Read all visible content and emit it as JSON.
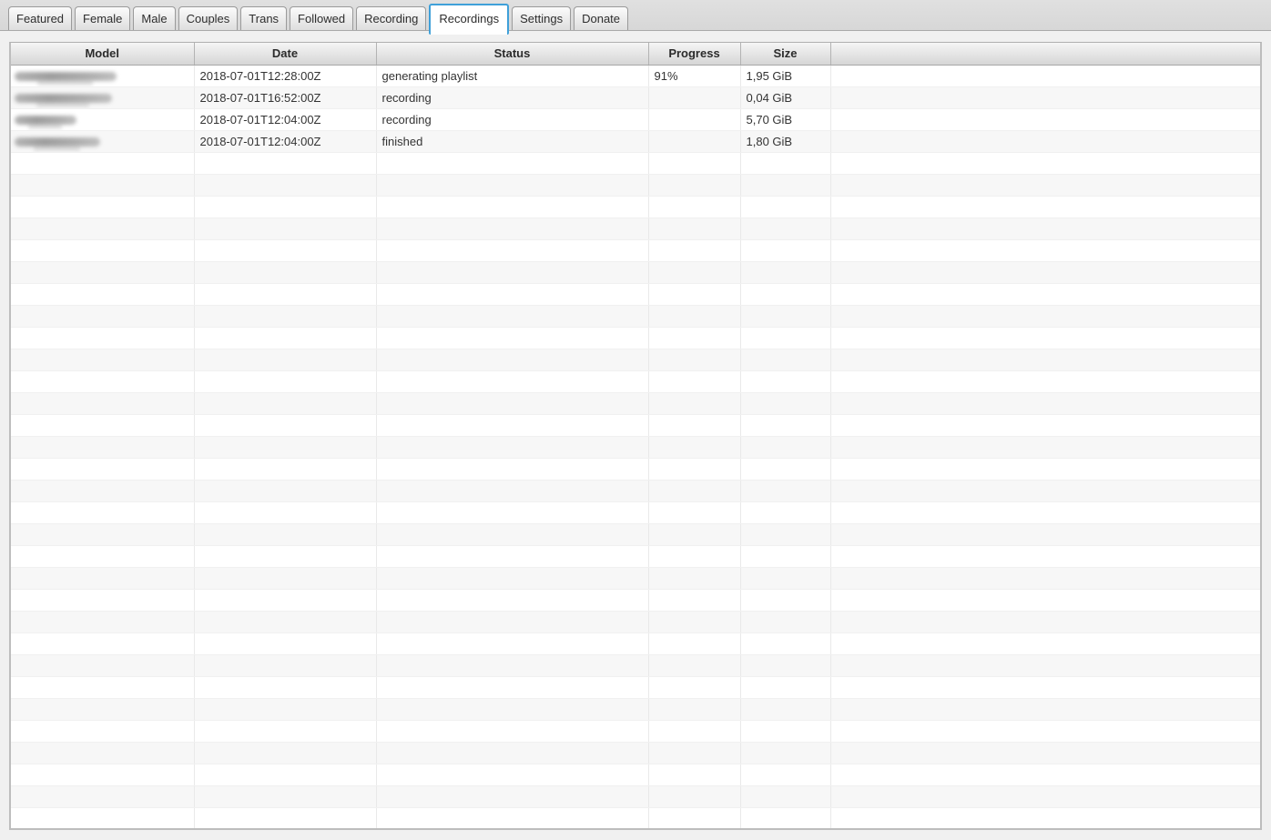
{
  "tab_bar": {
    "tabs": [
      {
        "label": "Featured",
        "selected": false
      },
      {
        "label": "Female",
        "selected": false
      },
      {
        "label": "Male",
        "selected": false
      },
      {
        "label": "Couples",
        "selected": false
      },
      {
        "label": "Trans",
        "selected": false
      },
      {
        "label": "Followed",
        "selected": false
      },
      {
        "label": "Recording",
        "selected": false
      },
      {
        "label": "Recordings",
        "selected": true
      },
      {
        "label": "Settings",
        "selected": false
      },
      {
        "label": "Donate",
        "selected": false
      }
    ]
  },
  "table": {
    "columns": [
      {
        "label": "Model"
      },
      {
        "label": "Date"
      },
      {
        "label": "Status"
      },
      {
        "label": "Progress"
      },
      {
        "label": "Size"
      },
      {
        "label": ""
      }
    ],
    "rows": [
      {
        "model_redacted": true,
        "model_blob_width": 112,
        "date": "2018-07-01T12:28:00Z",
        "status": "generating playlist",
        "progress": "91%",
        "size": "1,95 GiB"
      },
      {
        "model_redacted": true,
        "model_blob_width": 107,
        "date": "2018-07-01T16:52:00Z",
        "status": "recording",
        "progress": "",
        "size": "0,04 GiB"
      },
      {
        "model_redacted": true,
        "model_blob_width": 68,
        "date": "2018-07-01T12:04:00Z",
        "status": "recording",
        "progress": "",
        "size": "5,70 GiB"
      },
      {
        "model_redacted": true,
        "model_blob_width": 94,
        "date": "2018-07-01T12:04:00Z",
        "status": "finished",
        "progress": "",
        "size": "1,80 GiB"
      }
    ],
    "total_rows_visible": 35
  },
  "colors": {
    "selected_tab_border": "#3fa0d9",
    "page_background": "#f0f0f0",
    "tab_strip_background": "#dcdcdc",
    "row_stripe": "#f7f7f7",
    "header_text": "#2b2b2b"
  }
}
